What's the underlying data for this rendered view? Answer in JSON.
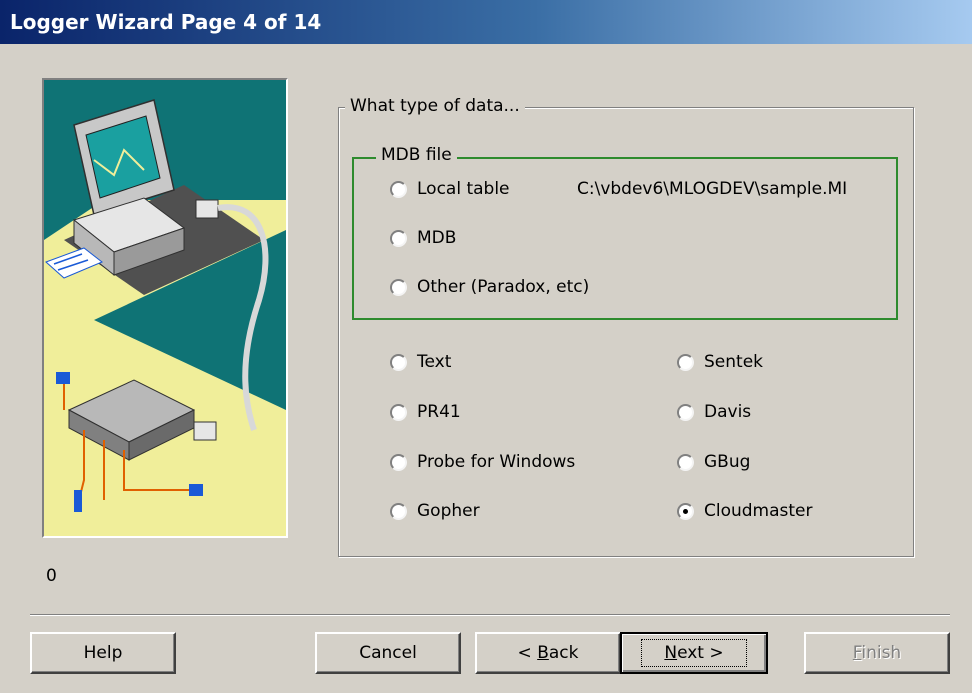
{
  "window": {
    "title": "Logger Wizard Page 4 of 14"
  },
  "status_counter": "0",
  "data_type_group": {
    "legend": "What type of data...",
    "mdb_group": {
      "legend": "MDB file",
      "options": [
        {
          "label": "Local table",
          "selected": false
        },
        {
          "label": "MDB",
          "selected": false
        },
        {
          "label": "Other (Paradox, etc)",
          "selected": false
        }
      ],
      "file_path": "C:\\vbdev6\\MLOGDEV\\sample.MI"
    },
    "left_options": [
      {
        "label": "Text",
        "selected": false
      },
      {
        "label": "PR41",
        "selected": false
      },
      {
        "label": "Probe for Windows",
        "selected": false
      },
      {
        "label": "Gopher",
        "selected": false
      }
    ],
    "right_options": [
      {
        "label": "Sentek",
        "selected": false
      },
      {
        "label": "Davis",
        "selected": false
      },
      {
        "label": "GBug",
        "selected": false
      },
      {
        "label": "Cloudmaster",
        "selected": true
      }
    ]
  },
  "buttons": {
    "help": "Help",
    "cancel": "Cancel",
    "back_prefix": "< ",
    "back_accel": "B",
    "back_rest": "ack",
    "next_accel": "N",
    "next_rest": "ext >",
    "finish_accel": "F",
    "finish_rest": "inish",
    "finish_enabled": false
  },
  "colors": {
    "title_start": "#0a246a",
    "title_end": "#a6caf0",
    "dialog_bg": "#d4d0c8",
    "mdb_border": "#2e8b2e",
    "illustration_bg": "#0f7375",
    "illustration_floor": "#f0ee9a"
  }
}
